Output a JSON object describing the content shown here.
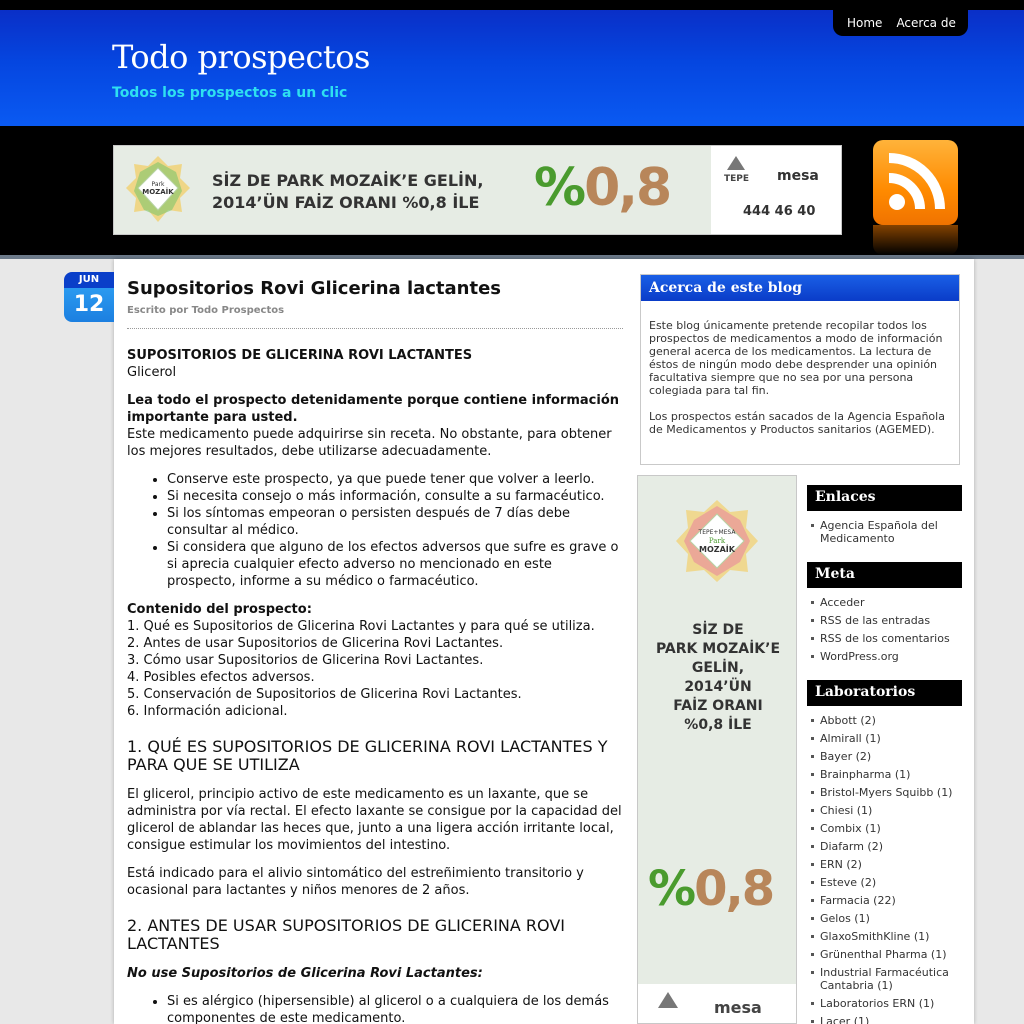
{
  "nav": {
    "home": "Home",
    "about": "Acerca de"
  },
  "site": {
    "title": "Todo prospectos",
    "description": "Todos los prospectos a un clic"
  },
  "ads": {
    "top_text_1": "SİZ DE PARK MOZAİK’E GELİN,",
    "top_text_2": "2014’ÜN FAİZ ORANI %0,8 İLE",
    "rate_pct": "%",
    "rate_num": "0,8",
    "brand_tepe": "TEPE",
    "brand_mesa": "mesa",
    "phone": "444 46 40",
    "side_lines": [
      "SİZ DE",
      "PARK MOZAİK’E",
      "GELİN,",
      "2014’ÜN",
      "FAİZ ORANI",
      "%0,8 İLE"
    ],
    "side_pct": "%",
    "side_num": "0,8",
    "side_mesa": "mesa"
  },
  "date": {
    "month": "JUN",
    "day": "12"
  },
  "post": {
    "title": "Supositorios Rovi Glicerina lactantes",
    "meta": "Escrito por Todo Prospectos",
    "name_heading": "SUPOSITORIOS DE GLICERINA ROVI LACTANTES",
    "substance": "Glicerol",
    "warn_bold": "Lea todo el prospecto detenidamente porque contiene información importante para usted.",
    "warn_text": "Este medicamento puede adquirirse sin receta. No obstante, para obtener los mejores resultados, debe utilizarse adecuadamente.",
    "bullets": [
      "Conserve este prospecto, ya que puede tener que volver a leerlo.",
      "Si necesita consejo o más información, consulte a su farmacéutico.",
      "Si los síntomas empeoran o persisten después de 7 días debe consultar al médico.",
      "Si considera que alguno de los efectos adversos que sufre es grave o si aprecia cualquier efecto adverso no mencionado en este prospecto, informe a su médico o farmacéutico."
    ],
    "contents_title": "Contenido del prospecto:",
    "contents": [
      "1. Qué es Supositorios de Glicerina Rovi Lactantes y para qué se utiliza.",
      "2. Antes de usar Supositorios de Glicerina Rovi Lactantes.",
      "3. Cómo usar Supositorios de Glicerina Rovi Lactantes.",
      "4. Posibles efectos adversos.",
      "5. Conservación de Supositorios de Glicerina Rovi Lactantes.",
      "6. Información adicional."
    ],
    "h1": "1. QUÉ ES SUPOSITORIOS DE GLICERINA ROVI LACTANTES Y PARA QUE SE UTILIZA",
    "p1": "El glicerol, principio activo de este medicamento es un laxante, que se administra por vía rectal. El efecto laxante se consigue por la capacidad del glicerol de ablandar las heces que, junto a una ligera acción irritante local, consigue estimular los movimientos del intestino.",
    "p2": "Está indicado para el alivio sintomático del estreñimiento transitorio y ocasional para lactantes y niños menores de 2 años.",
    "h2": "2. ANTES DE USAR SUPOSITORIOS DE GLICERINA ROVI LACTANTES",
    "no_use": "No use Supositorios de Glicerina Rovi Lactantes:",
    "bullets2": [
      "Si es alérgico (hipersensible) al glicerol o a cualquiera de los demás componentes de este medicamento."
    ]
  },
  "about_widget": {
    "title": "Acerca de este blog",
    "p1": "Este blog únicamente pretende recopilar todos los prospectos de medicamentos a modo de información general acerca de los medicamentos. La lectura de éstos de ningún modo debe desprender una opinión facultativa siempre que no sea por una persona colegiada para tal fin.",
    "p2": "Los prospectos están sacados de la Agencia Española de Medicamentos y Productos sanitarios (AGEMED)."
  },
  "enlaces": {
    "title": "Enlaces",
    "items": [
      "Agencia Española del Medicamento"
    ]
  },
  "meta_widget": {
    "title": "Meta",
    "items": [
      "Acceder",
      "RSS de las entradas",
      "RSS de los comentarios",
      "WordPress.org"
    ]
  },
  "labs": {
    "title": "Laboratorios",
    "items": [
      "Abbott (2)",
      "Almirall (1)",
      "Bayer (2)",
      "Brainpharma (1)",
      "Bristol-Myers Squibb (1)",
      "Chiesi (1)",
      "Combix (1)",
      "Diafarm (2)",
      "ERN (2)",
      "Esteve (2)",
      "Farmacia (22)",
      "Gelos (1)",
      "GlaxoSmithKline (1)",
      "Grünenthal Pharma (1)",
      "Industrial Farmacéutica Cantabria (1)",
      "Laboratorios ERN (1)",
      "Lacer (1)"
    ]
  },
  "colors": {
    "header_blue": "#0546e0",
    "tagline": "#2ee0f0",
    "date_badge": "#1c7fe0",
    "rss_orange": "#ff8a00"
  }
}
